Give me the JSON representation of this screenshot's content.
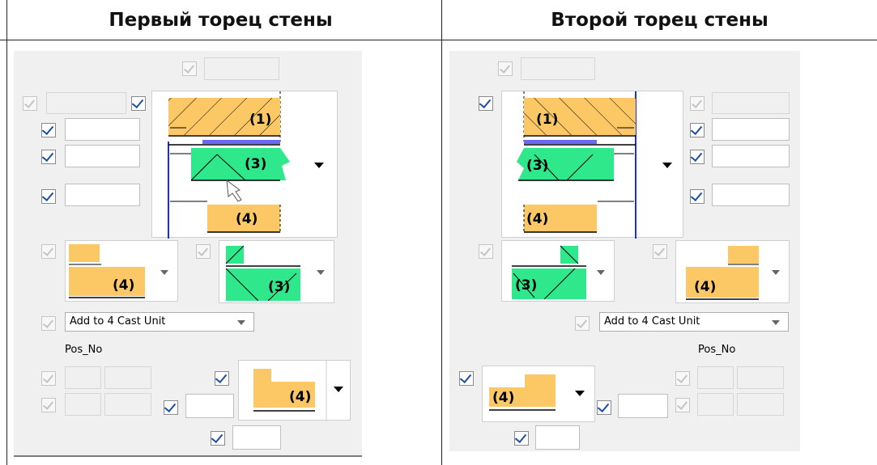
{
  "headers": {
    "left": "Первый торец стены",
    "right": "Второй торец стены"
  },
  "left_panel": {
    "cast_unit_combo": "Add to 4 Cast Unit",
    "pos_label": "Pos_No",
    "labels": {
      "p1": "(1)",
      "p3": "(3)",
      "p4": "(4)"
    }
  },
  "right_panel": {
    "cast_unit_combo": "Add to 4 Cast Unit",
    "pos_label": "Pos_No",
    "labels": {
      "p1": "(1)",
      "p3": "(3)",
      "p4": "(4)"
    }
  },
  "colors": {
    "orange": "#fcc865",
    "green": "#2ee88b",
    "blue_line": "#1a2fd6",
    "checkbox_check": "#1d4fa8"
  },
  "icons": [
    "checkbox",
    "dropdown-arrow",
    "mouse-cursor"
  ]
}
